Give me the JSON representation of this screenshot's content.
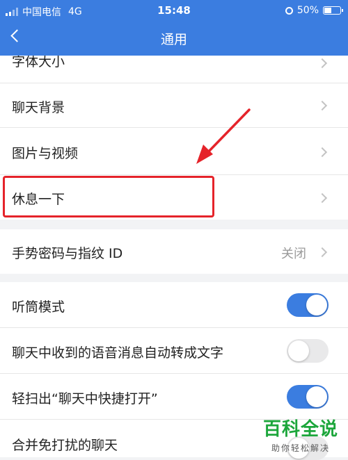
{
  "status_bar": {
    "carrier": "中国电信",
    "network": "4G",
    "time": "15:48",
    "battery": "50%",
    "battery_level": 0.5
  },
  "nav": {
    "title": "通用"
  },
  "rows": {
    "font_size": {
      "label": "字体大小"
    },
    "chat_background": {
      "label": "聊天背景"
    },
    "photos_videos": {
      "label": "图片与视频"
    },
    "take_a_break": {
      "label": "休息一下"
    },
    "gesture_password": {
      "label": "手势密码与指纹 ID",
      "value": "关闭"
    },
    "earpiece_mode": {
      "label": "听筒模式",
      "toggle": true
    },
    "voice_to_text": {
      "label": "聊天中收到的语音消息自动转成文字",
      "toggle": false
    },
    "quick_open": {
      "label": "轻扫出“聊天中快捷打开”",
      "toggle": true
    },
    "merge_muted": {
      "label": "合并免打扰的聊天",
      "toggle": false
    }
  },
  "colors": {
    "accent": "#3b7de0",
    "highlight": "#e5232a",
    "watermark": "#1ca63b"
  },
  "watermark": {
    "title": "百科全说",
    "subtitle": "助你轻松解决"
  }
}
